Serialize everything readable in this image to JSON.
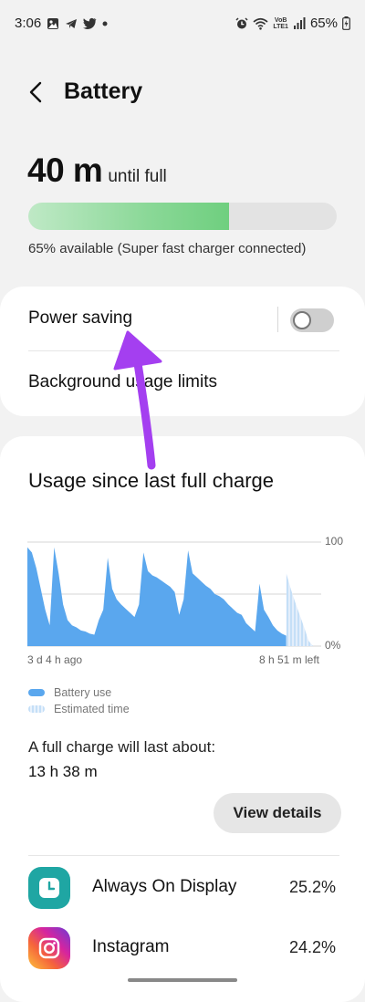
{
  "status_bar": {
    "time": "3:06",
    "battery_text": "65%",
    "left_icons": [
      "gallery-icon",
      "telegram-icon",
      "twitter-icon",
      "dot-icon"
    ],
    "right_icons": [
      "alarm-icon",
      "wifi-icon",
      "volte-icon",
      "signal-icon",
      "battery-charging-icon"
    ],
    "volte_line1": "VoB",
    "volte_line2": "LTE1"
  },
  "header": {
    "title": "Battery",
    "back_icon": "chevron-left-icon"
  },
  "battery": {
    "time_value": "40 m",
    "time_suffix": "until full",
    "level_fraction": 0.65,
    "status": "65% available (Super fast charger connected)",
    "fill_color": "#7fd48d"
  },
  "settings": {
    "power_saving_label": "Power saving",
    "power_saving_on": false,
    "background_limits_label": "Background usage limits"
  },
  "usage": {
    "title": "Usage since last full charge",
    "chart_start_label": "3 d 4 h ago",
    "chart_end_label": "8 h 51 m left",
    "y_top_label": "100",
    "y_bottom_label": "0%",
    "legend_battery_use": "Battery use",
    "legend_estimated": "Estimated time",
    "battery_color": "#5aa7ee",
    "estimated_color": "#c5dff7",
    "full_charge_label": "A full charge will last about:",
    "full_charge_value": "13 h 38 m",
    "view_details_label": "View details"
  },
  "chart_data": {
    "type": "area",
    "xlabel": "",
    "ylabel": "",
    "ylim": [
      0,
      100
    ],
    "grid": true,
    "x_range_labels": [
      "3 d 4 h ago",
      "8 h 51 m left"
    ],
    "series": [
      {
        "values": [
          95,
          90,
          75,
          55,
          35,
          20,
          95,
          70,
          40,
          25,
          20,
          18,
          15,
          14,
          12,
          11,
          25,
          35,
          85,
          55,
          45,
          40,
          36,
          32,
          28,
          40,
          90,
          72,
          68,
          66,
          63,
          60,
          57,
          52,
          30,
          45,
          92,
          70,
          66,
          62,
          58,
          55,
          50,
          48,
          45,
          40,
          36,
          32,
          30,
          22,
          18,
          14,
          60,
          35,
          28,
          20,
          15,
          12,
          10
        ]
      },
      {
        "values": [
          70,
          55,
          42,
          30,
          18,
          5,
          0
        ]
      }
    ]
  },
  "apps": [
    {
      "name": "Always On Display",
      "percent": "25.2%",
      "icon": "clock-icon",
      "color": "#1fa6a3"
    },
    {
      "name": "Instagram",
      "percent": "24.2%",
      "icon": "instagram-icon",
      "color": "#e1306c"
    }
  ]
}
